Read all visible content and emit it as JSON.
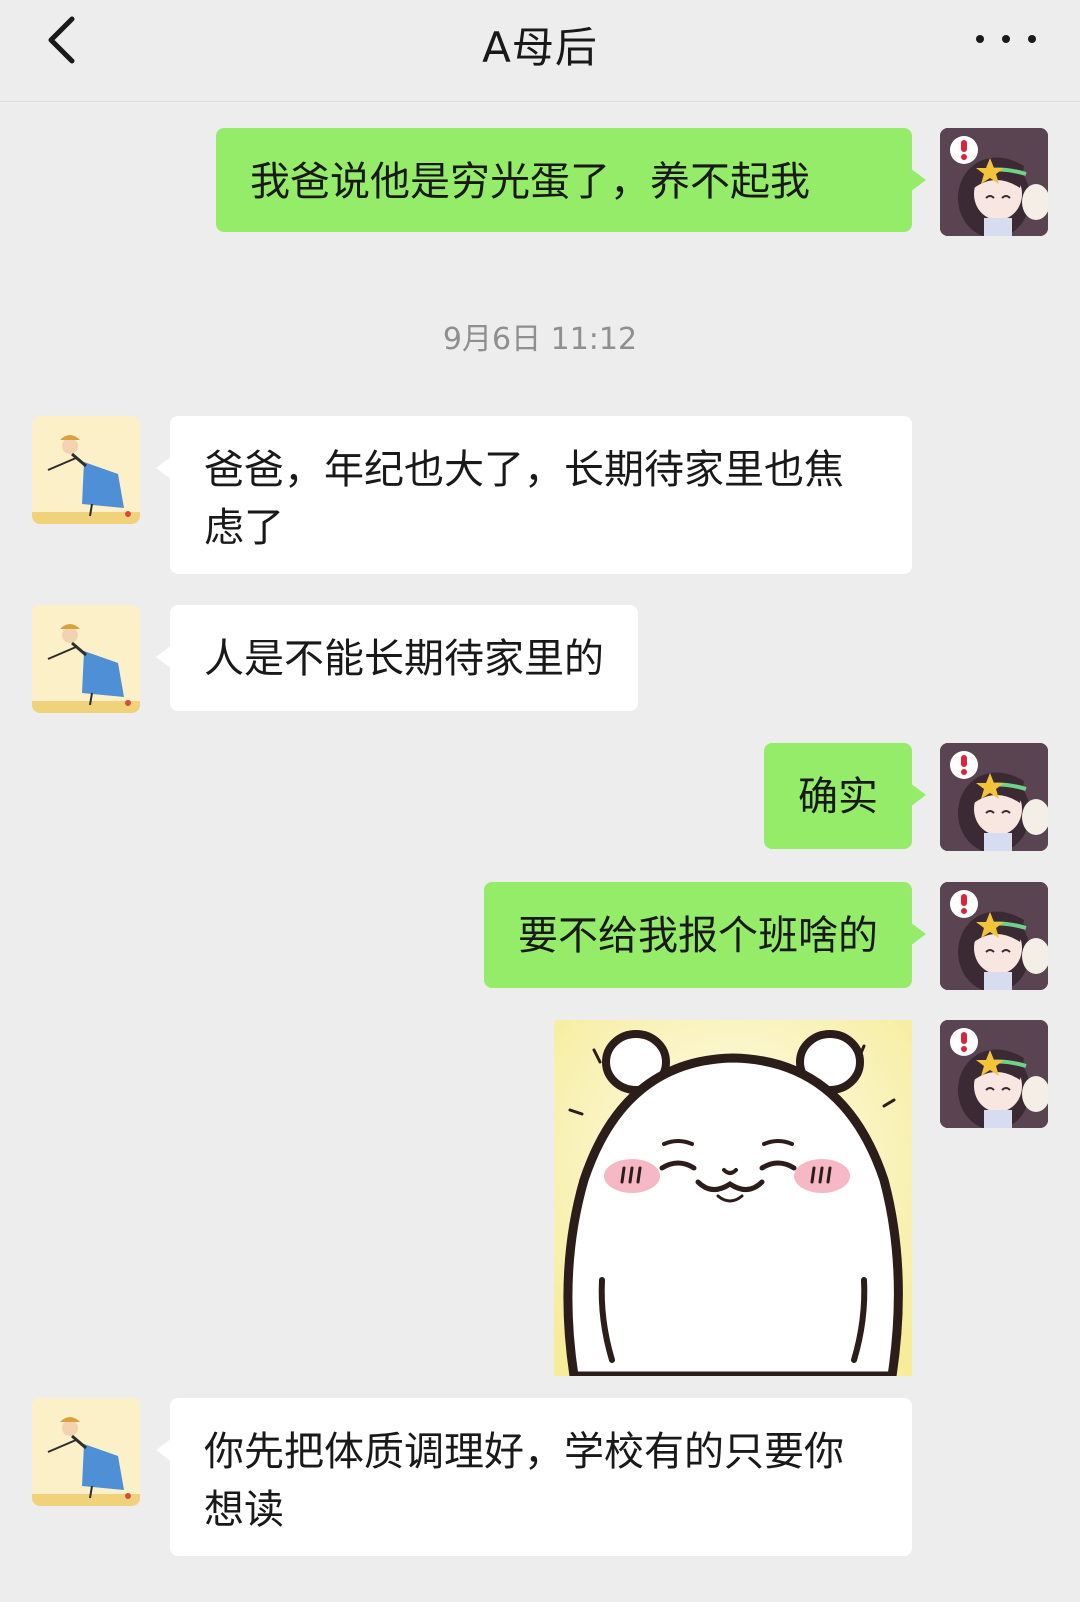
{
  "header": {
    "title": "A母后",
    "back_icon": "chevron-left-icon",
    "more_icon": "more-horizontal-icon"
  },
  "messages": [
    {
      "side": "mine",
      "text": "我爸说他是穷光蛋了，养不起我"
    },
    {
      "type": "timestamp",
      "text": "9月6日 11:12"
    },
    {
      "side": "theirs",
      "text": "爸爸，年纪也大了，长期待家里也焦虑了"
    },
    {
      "side": "theirs",
      "text": "人是不能长期待家里的"
    },
    {
      "side": "mine",
      "text": "确实"
    },
    {
      "side": "mine",
      "text": "要不给我报个班啥的"
    },
    {
      "side": "mine",
      "type": "sticker",
      "sticker_icon": "white-bear-sticker"
    },
    {
      "side": "theirs",
      "text": "你先把体质调理好，学校有的只要你想读"
    }
  ],
  "colors": {
    "background": "#ededed",
    "mine_bubble": "#95ec69",
    "theirs_bubble": "#ffffff",
    "timestamp": "#8f8f8f"
  }
}
